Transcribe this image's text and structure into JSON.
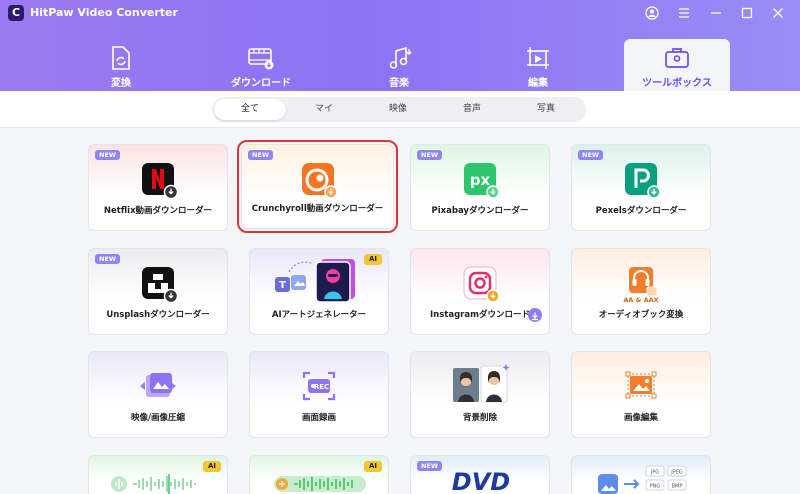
{
  "app": {
    "logo_letter": "C",
    "title": "HitPaw Video Converter"
  },
  "nav": {
    "tabs": [
      {
        "label": "変換"
      },
      {
        "label": "ダウンロード"
      },
      {
        "label": "音楽"
      },
      {
        "label": "編集"
      },
      {
        "label": "ツールボックス"
      }
    ],
    "active": "ツールボックス"
  },
  "filters": {
    "items": [
      "全て",
      "マイ",
      "映像",
      "音声",
      "写真"
    ],
    "active": "全て"
  },
  "badges": {
    "new": "NEW",
    "ai": "AI"
  },
  "dvd_logo": "DVD",
  "format_chips": [
    "JPG",
    "JPEG",
    "PNG",
    "BMP"
  ],
  "format_caption": "AA & AAX",
  "tools": [
    {
      "label": "Netflix動画ダウンローダー",
      "badge": "NEW"
    },
    {
      "label": "Crunchyroll動画ダウンローダー",
      "badge": "NEW",
      "selected": true
    },
    {
      "label": "Pixabayダウンローダー",
      "badge": "NEW"
    },
    {
      "label": "Pexelsダウンローダー",
      "badge": "NEW"
    },
    {
      "label": "Unsplashダウンローダー",
      "badge": "NEW"
    },
    {
      "label": "AIアートジェネレーター",
      "badge": "AI"
    },
    {
      "label": "Instagramダウンロード"
    },
    {
      "label": "オーディオブック変換"
    },
    {
      "label": "映像/画像圧縮"
    },
    {
      "label": "画面録画"
    },
    {
      "label": "背景削除"
    },
    {
      "label": "画像編集"
    },
    {
      "label": "",
      "badge": "AI"
    },
    {
      "label": "",
      "badge": "AI"
    },
    {
      "label": "",
      "badge": "NEW"
    },
    {
      "label": ""
    }
  ],
  "colors": {
    "accent": "#8b72f3",
    "selection": "#d73a36",
    "netflix": "#e50914",
    "crunchyroll": "#f47521",
    "pixabay": "#2ec66d",
    "pexels": "#07a081"
  },
  "icons": [
    "app-logo-icon",
    "user-icon",
    "menu-icon",
    "minimize-icon",
    "maximize-icon",
    "close-icon",
    "convert-icon",
    "download-icon",
    "music-icon",
    "edit-icon",
    "toolbox-icon"
  ]
}
